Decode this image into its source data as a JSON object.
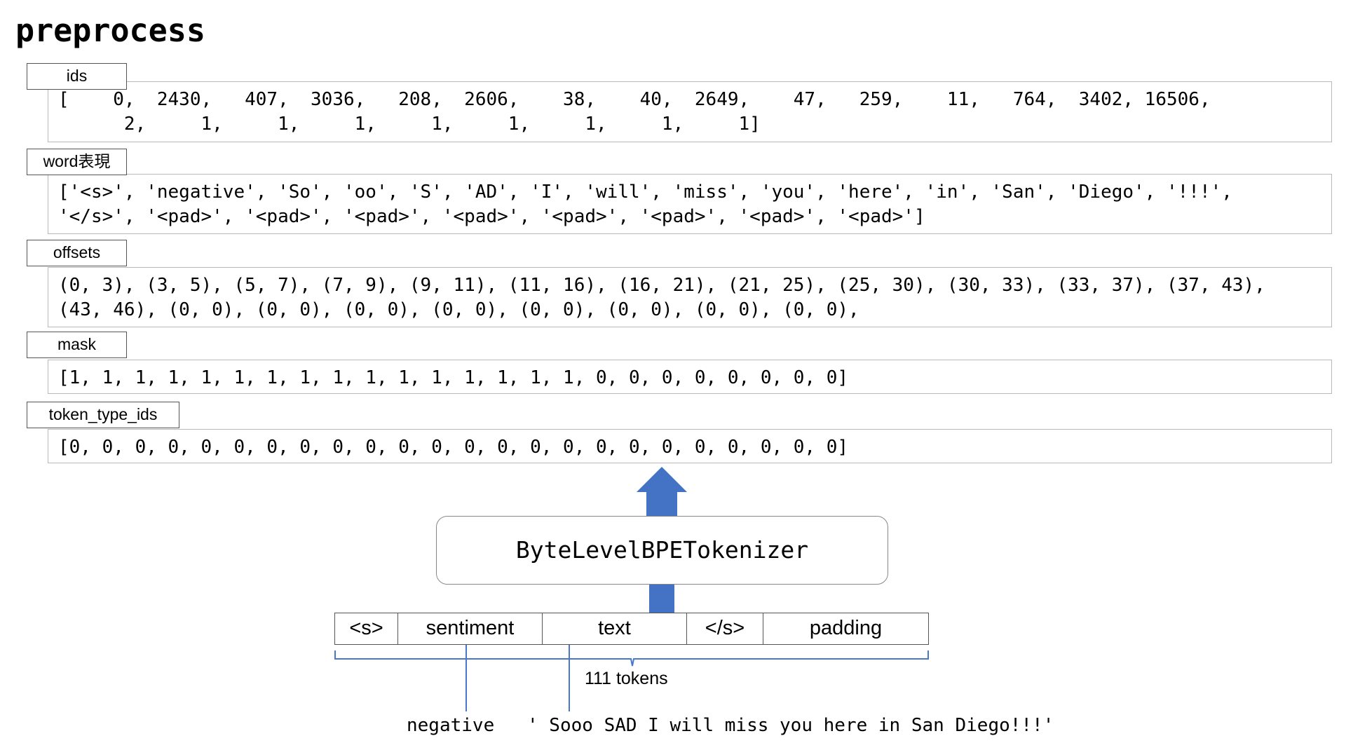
{
  "title": "preprocess",
  "fields": [
    {
      "label": "ids",
      "lines": [
        "[    0,  2430,   407,  3036,   208,  2606,    38,    40,  2649,    47,   259,    11,   764,  3402, 16506,",
        "      2,     1,     1,     1,     1,     1,     1,     1,     1]"
      ]
    },
    {
      "label": "word表現",
      "lines": [
        "['<s>', 'negative', 'So', 'oo', 'S', 'AD', 'I', 'will', 'miss', 'you', 'here', 'in', 'San', 'Diego', '!!!',",
        "'</s>', '<pad>', '<pad>', '<pad>', '<pad>', '<pad>', '<pad>', '<pad>', '<pad>']"
      ]
    },
    {
      "label": "offsets",
      "lines": [
        "(0, 3), (3, 5), (5, 7), (7, 9), (9, 11), (11, 16), (16, 21), (21, 25), (25, 30), (30, 33), (33, 37), (37, 43),",
        "(43, 46), (0, 0), (0, 0), (0, 0), (0, 0), (0, 0), (0, 0), (0, 0), (0, 0),"
      ]
    },
    {
      "label": "mask",
      "lines": [
        "[1, 1, 1, 1, 1, 1, 1, 1, 1, 1, 1, 1, 1, 1, 1, 1, 0, 0, 0, 0, 0, 0, 0, 0]"
      ]
    },
    {
      "label": "token_type_ids",
      "lines": [
        "[0, 0, 0, 0, 0, 0, 0, 0, 0, 0, 0, 0, 0, 0, 0, 0, 0, 0, 0, 0, 0, 0, 0, 0]"
      ]
    }
  ],
  "tokenizer": {
    "label": "ByteLevelBPETokenizer"
  },
  "segments": [
    {
      "label": "<s>"
    },
    {
      "label": "sentiment"
    },
    {
      "label": "text"
    },
    {
      "label": "</s>"
    },
    {
      "label": "padding"
    }
  ],
  "token_count": "111 tokens",
  "inputs": {
    "sentiment": "negative",
    "text": "' Sooo SAD I will miss you here in San Diego!!!'"
  },
  "colors": {
    "arrow": "#4472c4",
    "brace": "#4a78c8",
    "pointer": "#4a78c8"
  }
}
